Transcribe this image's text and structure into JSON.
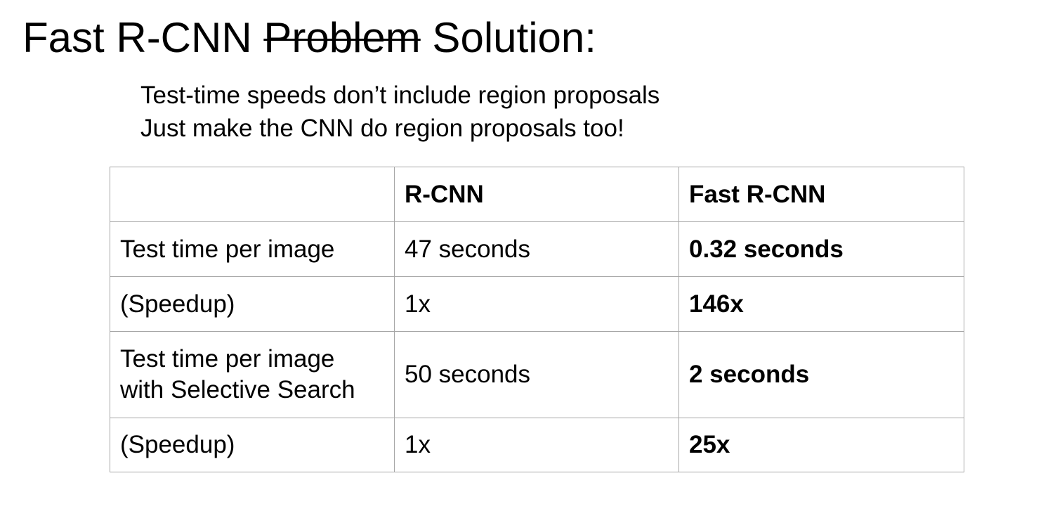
{
  "slide": {
    "title_prefix": "Fast R-CNN ",
    "title_struck": "Problem",
    "title_suffix": " Solution:",
    "lines": [
      "Test-time speeds don’t include region proposals",
      "Just make the CNN do region proposals too!"
    ]
  },
  "table": {
    "headers": [
      "",
      "R-CNN",
      "Fast R-CNN"
    ],
    "rows": [
      [
        "Test time per image",
        "47 seconds",
        "0.32 seconds"
      ],
      [
        "(Speedup)",
        "1x",
        "146x"
      ],
      [
        "Test time per image with Selective Search",
        "50 seconds",
        "2 seconds"
      ],
      [
        "(Speedup)",
        "1x",
        "25x"
      ]
    ]
  }
}
